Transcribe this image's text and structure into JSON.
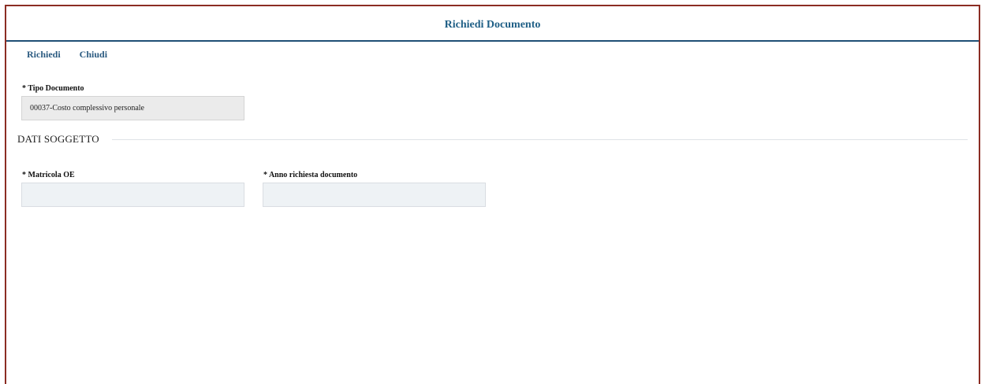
{
  "dialog": {
    "title": "Richiedi Documento"
  },
  "toolbar": {
    "request_label": "Richiedi",
    "close_label": "Chiudi"
  },
  "form": {
    "tipo_documento": {
      "label": "* Tipo Documento",
      "value": "00037-Costo complessivo personale"
    },
    "section_title": "DATI SOGGETTO",
    "matricola_oe": {
      "label": "* Matricola OE",
      "value": ""
    },
    "anno_richiesta": {
      "label": "* Anno richiesta documento",
      "value": ""
    }
  },
  "colors": {
    "frame_border": "#8b2d23",
    "header_rule": "#1f4f75",
    "title_text": "#1f5f86",
    "toolbar_text": "#2a5a80",
    "input_bg": "#eef2f5",
    "readonly_bg": "#ebebeb"
  }
}
